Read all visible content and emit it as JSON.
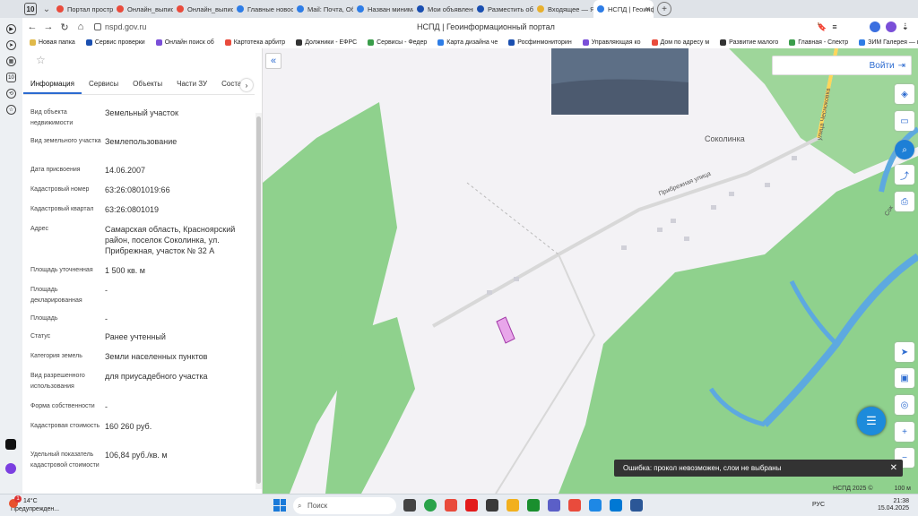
{
  "browser": {
    "tab_count": "10",
    "tabs": [
      {
        "label": "Портал простра",
        "color": "#e94b3c"
      },
      {
        "label": "Онлайн_выписк",
        "color": "#e94b3c"
      },
      {
        "label": "Онлайн_выписк",
        "color": "#e94b3c"
      },
      {
        "label": "Главные новост",
        "color": "#2e7de6"
      },
      {
        "label": "Mail: Почта, Обл",
        "color": "#2e7de6"
      },
      {
        "label": "Назван миниман",
        "color": "#2e7de6"
      },
      {
        "label": "Мои объявления",
        "color": "#1a4fb0"
      },
      {
        "label": "Разместить объ",
        "color": "#1a4fb0"
      },
      {
        "label": "Входящее — Янд",
        "color": "#e8b02e"
      },
      {
        "label": "НСПД | Геоинф",
        "color": "#2e7de6",
        "active": true
      }
    ],
    "url": "nspd.gov.ru",
    "page_title": "НСПД | Геоинформационный портал",
    "bookmarks": [
      "Новая папка",
      "Сервис проверки",
      "Онлайн поиск об",
      "Картотека арбитр",
      "Должники - ЕФРС",
      "Сервисы - Федер",
      "Карта дизайна че",
      "Росфинмониторин",
      "Управляющая ко",
      "Дом по адресу м",
      "Развитие малого",
      "Главная - Спектр",
      "ЗИМ Галерея — в"
    ]
  },
  "panel": {
    "tabs": [
      "Информация",
      "Сервисы",
      "Объекты",
      "Части ЗУ",
      "Соста"
    ],
    "fields": [
      {
        "label": "Вид объекта недвижимости",
        "value": "Земельный участок"
      },
      {
        "label": "Вид земельного участка",
        "value": "Землепользование"
      },
      {
        "label": "Дата присвоения",
        "value": "14.06.2007"
      },
      {
        "label": "Кадастровый номер",
        "value": "63:26:0801019:66"
      },
      {
        "label": "Кадастровый квартал",
        "value": "63:26:0801019"
      },
      {
        "label": "Адрес",
        "value": "Самарская область, Красноярский район, поселок Соколинка, ул. Прибрежная, участок № 32 А"
      },
      {
        "label": "Площадь уточненная",
        "value": "1 500 кв. м"
      },
      {
        "label": "Площадь декларированная",
        "value": "-"
      },
      {
        "label": "Площадь",
        "value": "-"
      },
      {
        "label": "Статус",
        "value": "Ранее учтенный"
      },
      {
        "label": "Категория земель",
        "value": "Земли населенных пунктов"
      },
      {
        "label": "Вид разрешенного использования",
        "value": "для приусадебного участка"
      },
      {
        "label": "Форма собственности",
        "value": "-"
      },
      {
        "label": "Кадастровая стоимость",
        "value": "160 260 руб."
      },
      {
        "label": "Удельный показатель кадастровой стоимости",
        "value": "106,84 руб./кв. м"
      }
    ]
  },
  "map": {
    "login_label": "Войти",
    "place_name": "Соколинка",
    "street_name": "Прибрежная улица",
    "road_name": "улица Чесноковка",
    "river_label": "Сок",
    "error_text": "Ошибка: прокол невозможен, слои не выбраны",
    "copyright": "НСПД 2025 ©",
    "scale_label": "100 м"
  },
  "taskbar": {
    "temperature": "14°C",
    "weather_text": "Предупрежден...",
    "search_placeholder": "Поиск",
    "language": "РУС",
    "time": "21:38",
    "date": "15.04.2025",
    "badge": "1"
  }
}
